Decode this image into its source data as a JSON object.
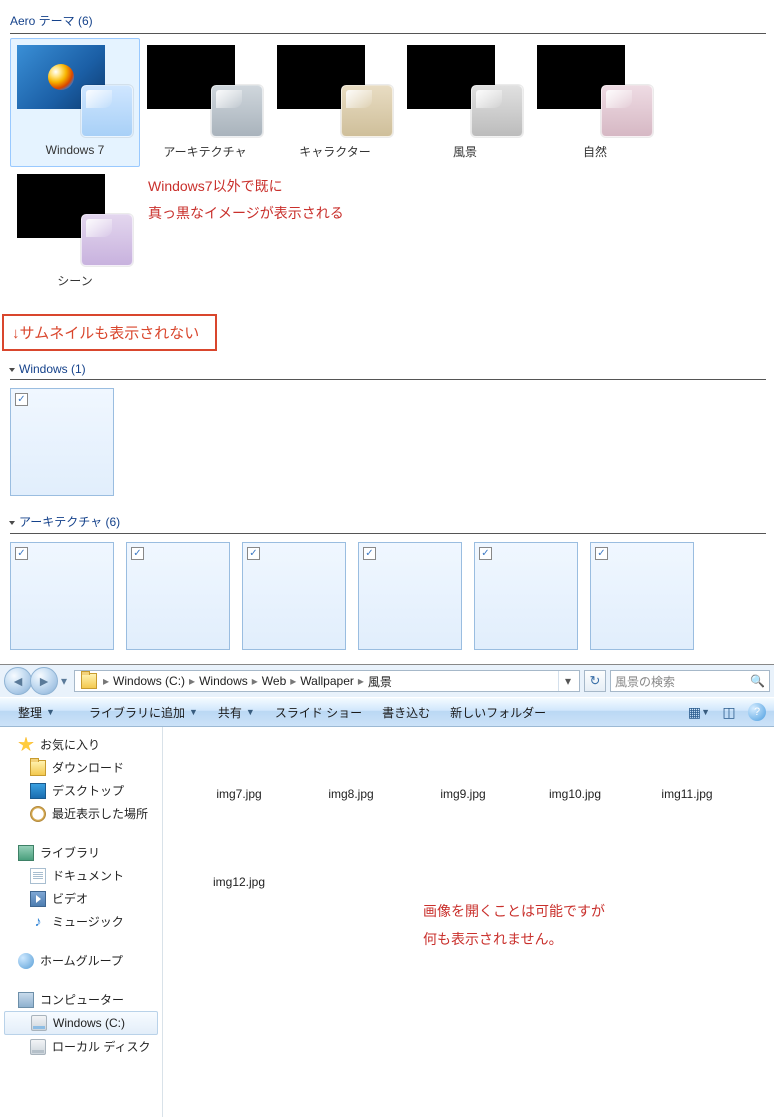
{
  "aero": {
    "title": "Aero テーマ (6)",
    "themes": [
      {
        "label": "Windows 7",
        "glass": "g-blue",
        "win7": true,
        "sel": true
      },
      {
        "label": "アーキテクチャ",
        "glass": "g-slate"
      },
      {
        "label": "キャラクター",
        "glass": "g-tan"
      },
      {
        "label": "風景",
        "glass": "g-grey"
      },
      {
        "label": "自然",
        "glass": "g-rose"
      },
      {
        "label": "シーン",
        "glass": "g-violet"
      }
    ],
    "callout1": "Windows7以外で既に",
    "callout2": "真っ黒なイメージが表示される"
  },
  "redbox": "↓サムネイルも表示されない",
  "wallpick": {
    "group1": "Windows (1)",
    "group2": "アーキテクチャ (6)"
  },
  "explorer": {
    "breadcrumb": [
      "Windows (C:)",
      "Windows",
      "Web",
      "Wallpaper",
      "風景"
    ],
    "search_placeholder": "風景の検索",
    "toolbar": {
      "organize": "整理",
      "addlib": "ライブラリに追加",
      "share": "共有",
      "slideshow": "スライド ショー",
      "burn": "書き込む",
      "newfolder": "新しいフォルダー"
    },
    "nav": {
      "favorites": "お気に入り",
      "downloads": "ダウンロード",
      "desktop": "デスクトップ",
      "recent": "最近表示した場所",
      "libraries": "ライブラリ",
      "documents": "ドキュメント",
      "videos": "ビデオ",
      "music": "ミュージック",
      "homegroup": "ホームグループ",
      "computer": "コンピューター",
      "cdrive": "Windows (C:)",
      "localdisk": "ローカル ディスク"
    },
    "files": [
      "img7.jpg",
      "img8.jpg",
      "img9.jpg",
      "img10.jpg",
      "img11.jpg",
      "img12.jpg"
    ],
    "callout1": "画像を開くことは可能ですが",
    "callout2": "何も表示されません。"
  }
}
